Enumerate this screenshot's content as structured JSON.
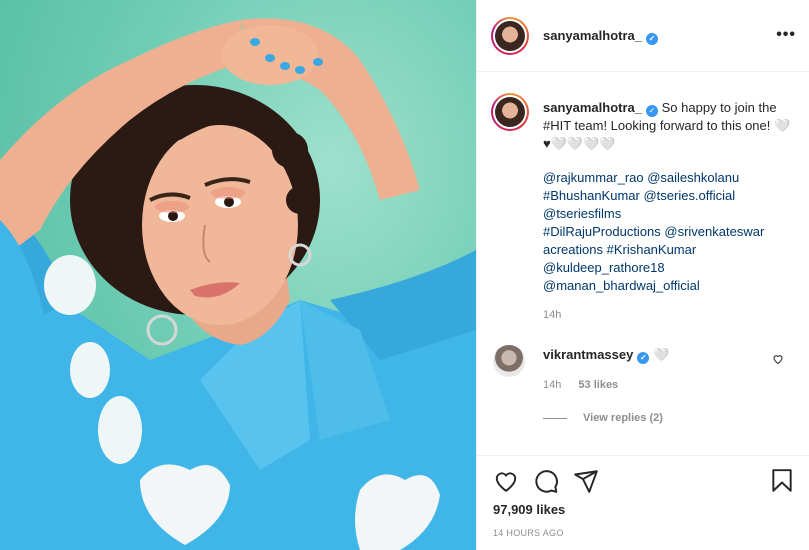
{
  "photo": {
    "alt": "sanyamalhotra_ post photo"
  },
  "header": {
    "username": "sanyamalhotra_",
    "verified_mark": "✓",
    "more_label": "•••"
  },
  "caption": {
    "username": "sanyamalhotra_",
    "verified_mark": "✓",
    "text": "So happy to join the #HIT team! Looking forward to this one! 🤍♥🤍🤍🤍🤍",
    "tags": [
      "@rajkummar_rao @saileshkolanu",
      "#BhushanKumar @tseries.official",
      "@tseriesfilms",
      "#DilRajuProductions @srivenkateswar",
      "acreations #KrishanKumar",
      "@kuldeep_rathore18",
      "@manan_bhardwaj_official"
    ],
    "time": "14h"
  },
  "comment": {
    "username": "vikrantmassey",
    "verified_mark": "✓",
    "text": "🤍",
    "time": "14h",
    "likes": "53 likes",
    "view_replies": "View replies (2)"
  },
  "actions": {
    "likes": "97,909 likes",
    "posted": "14 HOURS AGO"
  },
  "icons": {
    "more": "more-options-icon",
    "like": "heart-icon",
    "comment": "comment-icon",
    "share": "share-icon",
    "save": "bookmark-icon",
    "comment_like": "heart-small-icon",
    "verified": "verified-badge-icon"
  },
  "colors": {
    "verified": "#3897f0",
    "link": "#00376b",
    "muted": "#8e8e8e",
    "photo_bg": "#6fcdb4",
    "shirt": "#3fb5e8"
  }
}
